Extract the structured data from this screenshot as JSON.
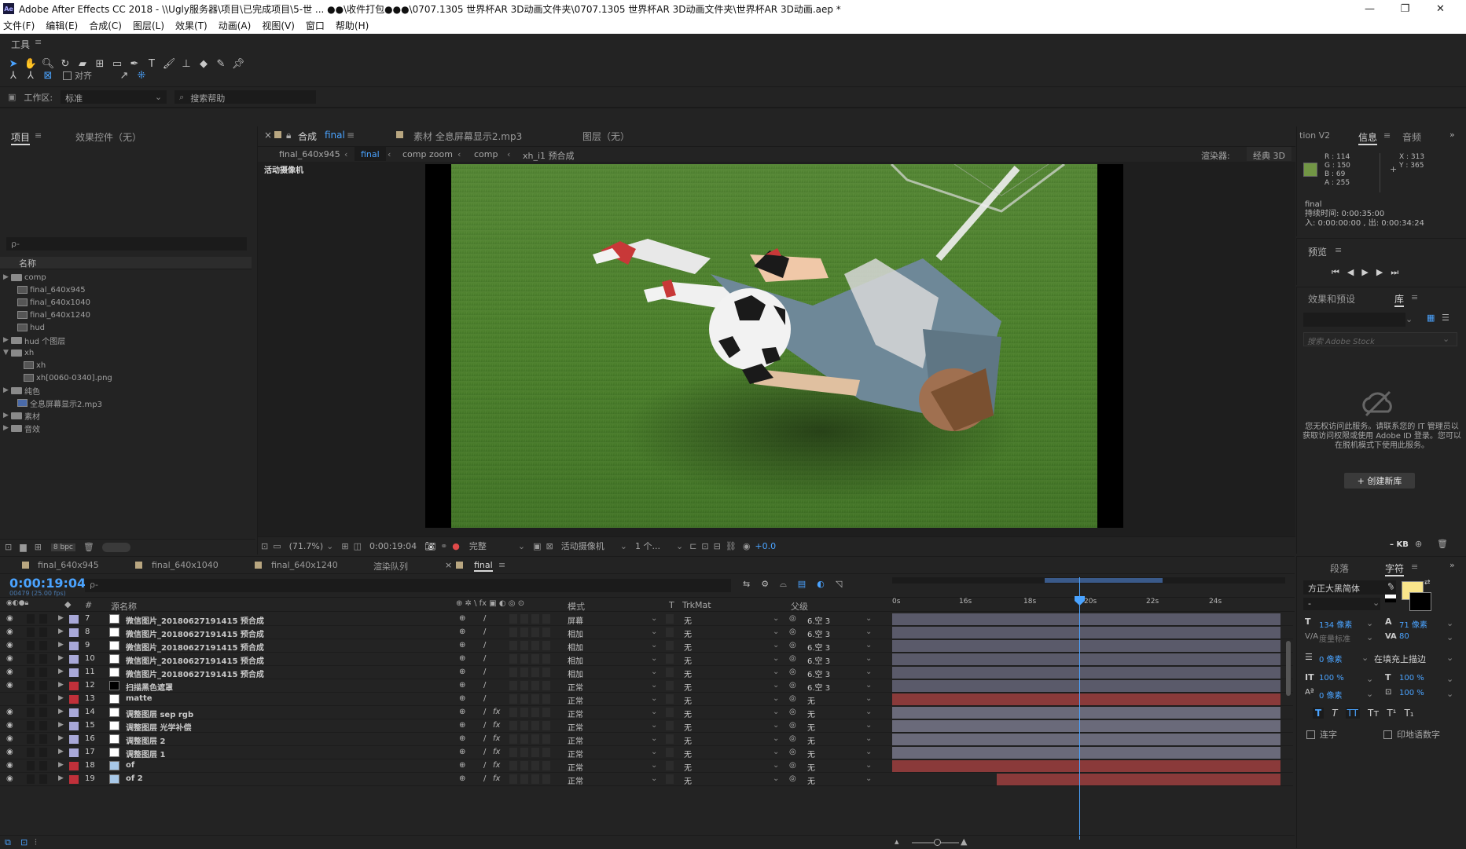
{
  "window": {
    "title": "Adobe After Effects CC 2018 - \\\\Ugly服务器\\项目\\已完成项目\\5-世 ... ●●\\收件打包●●●\\0707.1305 世界杯AR 3D动画文件夹\\0707.1305 世界杯AR 3D动画文件夹\\世界杯AR 3D动画.aep *",
    "logo": "Ae"
  },
  "menu": [
    "文件(F)",
    "编辑(E)",
    "合成(C)",
    "图层(L)",
    "效果(T)",
    "动画(A)",
    "视图(V)",
    "窗口",
    "帮助(H)"
  ],
  "toolbar": {
    "title": "工具",
    "align_label": "对齐"
  },
  "workspace": {
    "label": "工作区:",
    "value": "标准",
    "search_placeholder": "搜索帮助"
  },
  "project": {
    "tab_project": "项目",
    "tab_effects": "效果控件（无）",
    "search_placeholder": "ρ-",
    "col_name": "名称",
    "items": [
      {
        "label": "comp",
        "type": "folder",
        "indent": 0,
        "tw": "▶"
      },
      {
        "label": "final_640x945",
        "type": "comp",
        "indent": 1,
        "tw": ""
      },
      {
        "label": "final_640x1040",
        "type": "comp",
        "indent": 1,
        "tw": ""
      },
      {
        "label": "final_640x1240",
        "type": "comp",
        "indent": 1,
        "tw": ""
      },
      {
        "label": "hud",
        "type": "comp",
        "indent": 1,
        "tw": ""
      },
      {
        "label": "hud 个图层",
        "type": "folder",
        "indent": 0,
        "tw": "▶"
      },
      {
        "label": "xh",
        "type": "folder",
        "indent": 0,
        "tw": "▼"
      },
      {
        "label": "xh",
        "type": "comp",
        "indent": 2,
        "tw": ""
      },
      {
        "label": "xh[0060-0340].png",
        "type": "image",
        "indent": 2,
        "tw": ""
      },
      {
        "label": "纯色",
        "type": "folder",
        "indent": 0,
        "tw": "▶"
      },
      {
        "label": "全息屏幕显示2.mp3",
        "type": "audio",
        "indent": 1,
        "tw": ""
      },
      {
        "label": "素材",
        "type": "folder",
        "indent": 0,
        "tw": "▶"
      },
      {
        "label": "音效",
        "type": "folder",
        "indent": 0,
        "tw": "▶"
      }
    ],
    "bpc": "8 bpc"
  },
  "viewer": {
    "tab_comp": "合成",
    "tab_comp_name": "final",
    "tab_footage": "素材 全息屏幕显示2.mp3",
    "tab_layer": "图层（无）",
    "breadcrumbs": [
      "final_640x945",
      "final",
      "comp zoom",
      "comp",
      "xh_i1 预合成"
    ],
    "renderer_label": "渲染器:",
    "renderer_value": "经典 3D",
    "camera_label": "活动摄像机",
    "zoom": "(71.7%)",
    "time": "0:00:19:04",
    "resolution": "完整",
    "view": "活动摄像机",
    "views_count": "1 个...",
    "exposure": "+0.0"
  },
  "info": {
    "tab_partial": "tion V2",
    "tab_info": "信息",
    "tab_audio": "音频",
    "r": "R : 114",
    "g": "G : 150",
    "b": "B : 69",
    "a": "A : 255",
    "x": "X : 313",
    "y": "Y : 365",
    "color": "#729645",
    "comp_name": "final",
    "duration": "持续时间: 0:00:35:00",
    "inout": "入: 0:00:00:00 , 出: 0:00:34:24"
  },
  "preview": {
    "title": "预览"
  },
  "effects_presets": {
    "title": "效果和预设",
    "tab_library": "库",
    "search_placeholder": "搜索 Adobe Stock",
    "no_access": "您无权访问此服务。请联系您的 IT 管理员以获取访问权限或使用 Adobe ID 登录。您可以在脱机模式下使用此服务。",
    "create_button": "+ 创建新库",
    "kb": "– KB"
  },
  "paragraph": {
    "tab": "段落",
    "tab_char": "字符"
  },
  "character": {
    "font": "方正大黑简体",
    "style": "-",
    "size": "134 像素",
    "leading": "71 像素",
    "kerning": "度量标准",
    "tracking": "80",
    "stroke": "0 像素",
    "stroke_type": "在填充上描边",
    "vscale": "100 %",
    "hscale": "100 %",
    "baseline": "0 像素",
    "tsume": "100 %",
    "ligature": "连字",
    "hindi": "印地语数字",
    "fill_color": "#f9e58b"
  },
  "timeline": {
    "tabs": [
      "final_640x945",
      "final_640x1040",
      "final_640x1240",
      "渲染队列",
      "final"
    ],
    "tab_colors": [
      "#b8a680",
      "#b8a680",
      "#b8a680",
      "",
      ""
    ],
    "current_time": "0:00:19:04",
    "frame_info": "00479 (25.00 fps)",
    "search_placeholder": "ρ-",
    "col_hash": "#",
    "col_name": "源名称",
    "col_mode": "模式",
    "col_t": "T",
    "col_trkmat": "TrkMat",
    "col_parent": "父级",
    "ruler": [
      "0s",
      "16s",
      "18s",
      "20s",
      "22s",
      "24s"
    ],
    "layers": [
      {
        "num": "7",
        "name": "微信图片_20180627191415 预合成",
        "mode": "屏幕",
        "trk": "无",
        "parent": "6.空 3",
        "color": "#a8a8d8",
        "swatch": "#fff",
        "bar": "#5a5a6a",
        "eye": true,
        "fx": false
      },
      {
        "num": "8",
        "name": "微信图片_20180627191415 预合成",
        "mode": "相加",
        "trk": "无",
        "parent": "6.空 3",
        "color": "#a8a8d8",
        "swatch": "#fff",
        "bar": "#5a5a6a",
        "eye": true,
        "fx": false
      },
      {
        "num": "9",
        "name": "微信图片_20180627191415 预合成",
        "mode": "相加",
        "trk": "无",
        "parent": "6.空 3",
        "color": "#a8a8d8",
        "swatch": "#fff",
        "bar": "#5a5a6a",
        "eye": true,
        "fx": false
      },
      {
        "num": "10",
        "name": "微信图片_20180627191415 预合成",
        "mode": "相加",
        "trk": "无",
        "parent": "6.空 3",
        "color": "#a8a8d8",
        "swatch": "#fff",
        "bar": "#5a5a6a",
        "eye": true,
        "fx": false
      },
      {
        "num": "11",
        "name": "微信图片_20180627191415 预合成",
        "mode": "相加",
        "trk": "无",
        "parent": "6.空 3",
        "color": "#a8a8d8",
        "swatch": "#fff",
        "bar": "#5a5a6a",
        "eye": true,
        "fx": false
      },
      {
        "num": "12",
        "name": "扫描黑色遮罩",
        "mode": "正常",
        "trk": "无",
        "parent": "6.空 3",
        "color": "#c0303a",
        "swatch": "#000",
        "bar": "#5a5a6a",
        "eye": true,
        "fx": false
      },
      {
        "num": "13",
        "name": "matte",
        "mode": "正常",
        "trk": "无",
        "parent": "无",
        "color": "#c0303a",
        "swatch": "#fff",
        "bar": "#8a3a3a",
        "eye": false,
        "fx": false
      },
      {
        "num": "14",
        "name": "调整图层 sep rgb",
        "mode": "正常",
        "trk": "无",
        "parent": "无",
        "color": "#a8a8d8",
        "swatch": "#fff",
        "bar": "#6a6a7a",
        "eye": true,
        "fx": true
      },
      {
        "num": "15",
        "name": "调整图层 光学补偿",
        "mode": "正常",
        "trk": "无",
        "parent": "无",
        "color": "#a8a8d8",
        "swatch": "#fff",
        "bar": "#6a6a7a",
        "eye": true,
        "fx": true
      },
      {
        "num": "16",
        "name": "调整图层 2",
        "mode": "正常",
        "trk": "无",
        "parent": "无",
        "color": "#a8a8d8",
        "swatch": "#fff",
        "bar": "#6a6a7a",
        "eye": true,
        "fx": true
      },
      {
        "num": "17",
        "name": "调整图层 1",
        "mode": "正常",
        "trk": "无",
        "parent": "无",
        "color": "#a8a8d8",
        "swatch": "#fff",
        "bar": "#6a6a7a",
        "eye": true,
        "fx": true
      },
      {
        "num": "18",
        "name": "of",
        "mode": "正常",
        "trk": "无",
        "parent": "无",
        "color": "#c0303a",
        "swatch": "#a8c8e8",
        "bar": "#8a3a3a",
        "eye": true,
        "fx": true
      },
      {
        "num": "19",
        "name": "of 2",
        "mode": "正常",
        "trk": "无",
        "parent": "无",
        "color": "#c0303a",
        "swatch": "#a8c8e8",
        "bar": "#8a3a3a",
        "eye": true,
        "fx": true
      }
    ]
  }
}
